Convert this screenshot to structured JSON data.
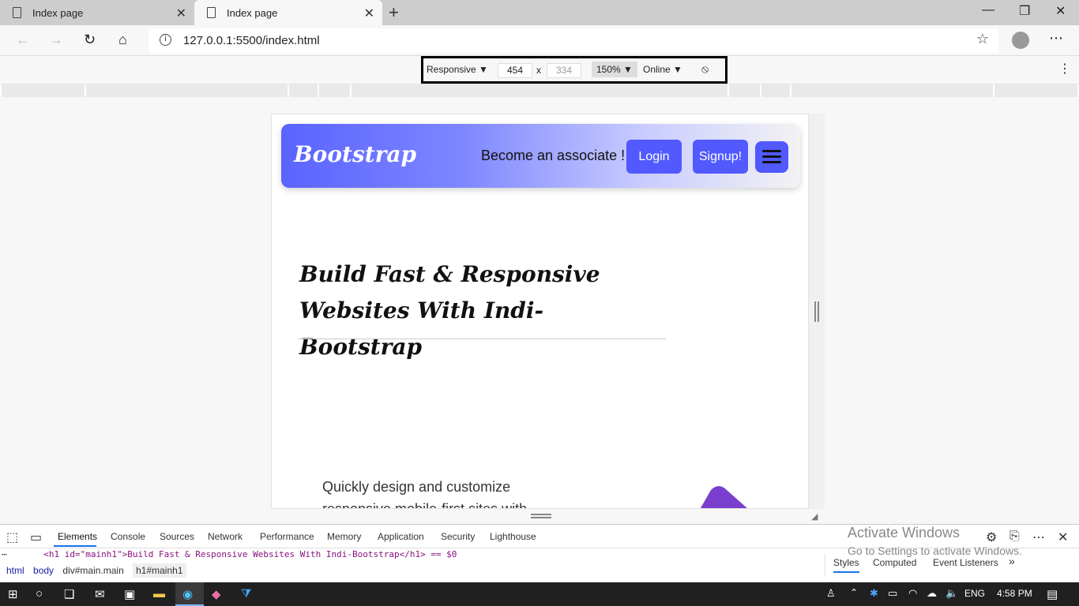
{
  "browser": {
    "tabs": [
      {
        "label": "Index page"
      },
      {
        "label": "Index page"
      }
    ],
    "url": "127.0.0.1:5500/index.html"
  },
  "device_toolbar": {
    "mode": "Responsive ▼",
    "width": "454",
    "times": "x",
    "height": "334",
    "zoom": "150% ▼",
    "network": "Online ▼"
  },
  "page": {
    "brand": "Bootstrap",
    "associate_text": "Become an associate !",
    "login_label": "Login",
    "signup_label": "Signup!",
    "heading": "Build Fast & Responsive Websites With Indi-Bootstrap",
    "lead": "Quickly design and customize responsive mobile-first sites with"
  },
  "devtools": {
    "tabs": [
      "Elements",
      "Console",
      "Sources",
      "Network",
      "Performance",
      "Memory",
      "Application",
      "Security",
      "Lighthouse"
    ],
    "code_line": "<h1 id=\"mainh1\">Build Fast & Responsive Websites With Indi-Bootstrap</h1> == $0",
    "breadcrumbs": [
      "html",
      "body",
      "div#main.main",
      "h1#mainh1"
    ],
    "side_tabs": [
      "Styles",
      "Computed",
      "Event Listeners"
    ],
    "watermark_line1": "Activate Windows",
    "watermark_line2": "Go to Settings to activate Windows."
  },
  "taskbar": {
    "lang": "ENG",
    "time": "4:58 PM"
  },
  "colors": {
    "accent": "#5159ff",
    "gradient_start": "#5a63ff",
    "taskbar": "#202020"
  }
}
